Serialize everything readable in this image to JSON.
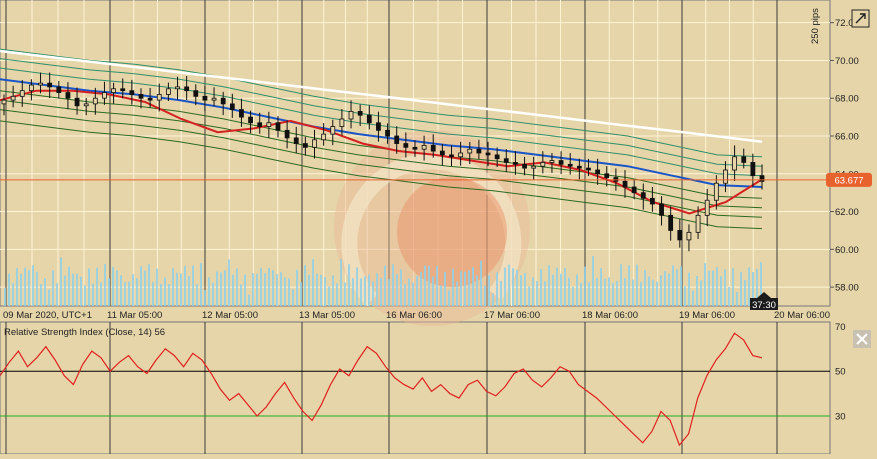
{
  "chart_data": [
    {
      "type": "candlestick",
      "title": "",
      "y_ticks": [
        "72.00",
        "70.00",
        "68.00",
        "66.00",
        "64.00",
        "62.00",
        "60.00",
        "58.00"
      ],
      "ylim": [
        57.0,
        73.2
      ],
      "pips_label": "250 pips",
      "current_price_label": "63.677",
      "current_price": 63.677,
      "countdown_label": "37:30",
      "x_ticks": [
        "09 Mar 2020, UTC+1",
        "11 Mar 05:00",
        "12 Mar 05:00",
        "13 Mar 05:00",
        "16 Mar 06:00",
        "17 Mar 06:00",
        "18 Mar 06:00",
        "19 Mar 06:00",
        "20 Mar 06:00"
      ],
      "grid": true,
      "series": [
        {
          "type": "candles",
          "values": [
            67.9,
            68.1,
            68.4,
            68.7,
            68.8,
            68.6,
            68.3,
            68.0,
            67.6,
            67.7,
            68.0,
            68.3,
            68.5,
            68.4,
            68.2,
            68.0,
            67.9,
            68.2,
            68.5,
            68.6,
            68.4,
            68.1,
            67.9,
            68.0,
            67.7,
            67.4,
            67.0,
            66.7,
            66.5,
            66.7,
            66.3,
            65.9,
            65.6,
            65.4,
            65.8,
            66.1,
            66.5,
            66.9,
            67.3,
            67.1,
            66.7,
            66.3,
            66.0,
            65.6,
            65.4,
            65.3,
            65.5,
            65.2,
            65.0,
            64.9,
            65.1,
            65.3,
            65.1,
            65.0,
            64.8,
            64.6,
            64.5,
            64.3,
            64.4,
            64.6,
            64.7,
            64.5,
            64.4,
            64.3,
            64.2,
            64.0,
            63.8,
            63.6,
            63.3,
            63.0,
            62.7,
            62.4,
            61.8,
            61.0,
            60.5,
            60.9,
            61.8,
            62.6,
            63.5,
            64.2,
            64.9,
            64.6,
            63.9,
            63.6
          ]
        },
        {
          "type": "line",
          "color": "#ffffff",
          "values": [
            70.5,
            70.2,
            69.9,
            69.6,
            69.3,
            69.0,
            68.7,
            68.4,
            68.1,
            67.8,
            67.5,
            67.2,
            66.9,
            66.6,
            66.3,
            66.0,
            65.7
          ]
        },
        {
          "type": "line",
          "color": "#1a55c8",
          "values": [
            69.0,
            68.7,
            68.4,
            68.2,
            67.9,
            67.5,
            67.0,
            66.5,
            66.1,
            65.8,
            65.5,
            65.3,
            65.0,
            64.7,
            64.4,
            63.9,
            63.4,
            63.3
          ]
        },
        {
          "type": "line",
          "color": "#d42020",
          "values": [
            67.9,
            68.4,
            68.4,
            68.2,
            67.8,
            66.9,
            66.2,
            66.4,
            66.8,
            66.3,
            65.6,
            65.2,
            65.0,
            64.7,
            64.4,
            64.6,
            64.2,
            63.5,
            62.5,
            61.9,
            62.5,
            63.7
          ]
        }
      ]
    },
    {
      "type": "line",
      "title": "Relative Strength Index (Close, 14) 56",
      "y_ticks": [
        "70",
        "50",
        "30"
      ],
      "ylim": [
        13,
        72
      ],
      "levels": [
        {
          "value": 50,
          "color": "#000000"
        },
        {
          "value": 30,
          "color": "#22aa22"
        }
      ],
      "series": [
        {
          "color": "#e02020",
          "values": [
            48,
            54,
            59,
            52,
            56,
            61,
            55,
            48,
            44,
            53,
            59,
            56,
            50,
            54,
            57,
            52,
            49,
            55,
            60,
            57,
            52,
            58,
            55,
            49,
            42,
            37,
            40,
            35,
            30,
            34,
            40,
            45,
            38,
            32,
            28,
            35,
            44,
            51,
            48,
            55,
            61,
            58,
            52,
            47,
            44,
            42,
            47,
            41,
            44,
            40,
            38,
            44,
            46,
            41,
            39,
            43,
            49,
            51,
            46,
            43,
            47,
            52,
            50,
            44,
            41,
            38,
            34,
            30,
            26,
            22,
            18,
            23,
            32,
            28,
            17,
            22,
            38,
            48,
            55,
            60,
            67,
            64,
            57,
            56
          ]
        }
      ]
    }
  ]
}
